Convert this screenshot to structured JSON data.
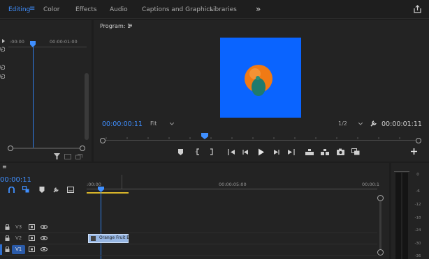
{
  "workspaces": {
    "tabs": [
      {
        "label": "Editing"
      },
      {
        "label": "Color"
      },
      {
        "label": "Effects"
      },
      {
        "label": "Audio"
      },
      {
        "label": "Captions and Graphics"
      },
      {
        "label": "Libraries"
      }
    ],
    "more": "»"
  },
  "source": {
    "ruler_start": ":00:00",
    "ruler_end": "00:00:01:00"
  },
  "program": {
    "title": "Program: 1",
    "menu": "≡",
    "timecode": "00:00:00:11",
    "fit": "Fit",
    "resolution": "1/2",
    "duration": "00:00:01:11",
    "frame_bg": "#0a64ff"
  },
  "timeline": {
    "menu": "≡",
    "timecode": "00:00:11",
    "ruler_start": ":00:00",
    "ruler_mid": "00:00:05:00",
    "ruler_end": "00:00:1",
    "tracks": [
      {
        "name": "V3"
      },
      {
        "name": "V2"
      },
      {
        "name": "V1"
      }
    ],
    "clip_label": "Orange Fruit B"
  },
  "meter": {
    "labels": [
      "0",
      "-6",
      "-12",
      "-18",
      "-24",
      "-30",
      "-36"
    ]
  },
  "colors": {
    "accent": "#3f8fff",
    "playhead": "#2f7ee8",
    "workarea": "#d8b52a",
    "clip": "#97b7e4"
  }
}
